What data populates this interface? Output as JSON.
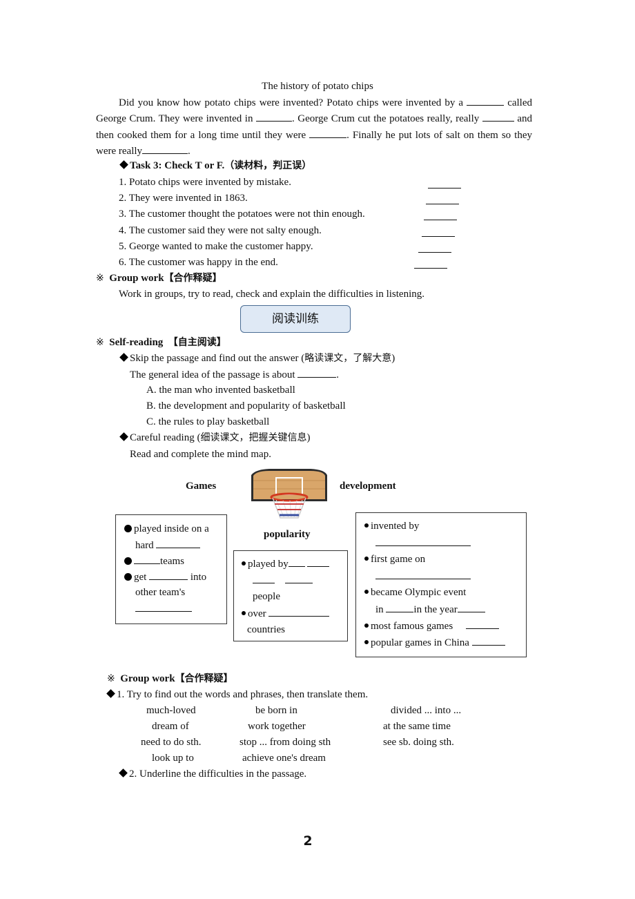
{
  "passage": {
    "title": "The history of potato chips",
    "segments": [
      "Did you know how potato chips were invented? Potato chips were invented by a ",
      " called George Crum. They were invented in ",
      ". George Crum cut the potatoes really, really ",
      " and then cooked them for a long time until they were ",
      ". Finally he put lots of salt on them so they were really",
      "."
    ]
  },
  "task3": {
    "heading": "Task 3: Check T or F.",
    "heading_cn": "（读材料，判正误）",
    "items": [
      "1. Potato chips were invented by mistake.",
      "2. They were invented in 1863.",
      "3. The customer thought the potatoes were not thin enough.",
      "4. The customer said they were not salty enough.",
      "5. George wanted to make the customer happy.",
      "6. The customer was happy in the end."
    ]
  },
  "group_work_1": {
    "marker": "※",
    "heading": "Group work",
    "heading_cn": "【合作释疑】",
    "text": "Work in groups, try to read, check and explain the difficulties in listening."
  },
  "banner": {
    "label": "阅读训练"
  },
  "self_reading": {
    "marker": "※",
    "heading": "Self-reading",
    "heading_cn": "【自主阅读】",
    "skip": {
      "text": "Skip the passage and find out the answer (",
      "cn": "略读课文，了解大意",
      "end": ")"
    },
    "question": "The general idea of the passage is about ",
    "question_end": ".",
    "options": [
      "A. the man who invented basketball",
      "B. the development and popularity of basketball",
      "C. the rules to play basketball"
    ],
    "careful": {
      "text": "Careful reading (",
      "cn": "细读课文，把握关键信息",
      "end": ")"
    },
    "instruction": "Read and complete the mind map."
  },
  "mind_map": {
    "image_label": "basketball-hoop",
    "labels": {
      "games": "Games",
      "development": "development",
      "popularity": "popularity"
    },
    "games_box": {
      "l1": "played inside on a",
      "l2": "hard ",
      "l3": "teams",
      "l4a": "get ",
      "l4b": " into",
      "l5": "other team's"
    },
    "popularity_box": {
      "l1": "played by",
      "l3": "people",
      "l4": "over ",
      "l5": "countries"
    },
    "development_box": {
      "l1": "invented by",
      "l3": "first game on",
      "l5": "became Olympic event",
      "l6a": "in ",
      "l6b": "in the year",
      "l7": "most famous games",
      "l8": "popular games in China "
    }
  },
  "group_work_2": {
    "marker": "※",
    "heading": "Group work",
    "heading_cn": "【合作释疑】",
    "task1": "1. Try to find out the words and phrases, then translate them.",
    "phrases": [
      [
        "much-loved",
        "be born in",
        "divided ... into ..."
      ],
      [
        "dream of",
        "work together",
        "at the same time"
      ],
      [
        "need to do sth.",
        "stop ... from doing sth",
        "see sb. doing sth."
      ],
      [
        "look up to",
        "achieve one's dream",
        ""
      ]
    ],
    "task2": "2. Underline the difficulties in the passage."
  },
  "page_number": "2"
}
